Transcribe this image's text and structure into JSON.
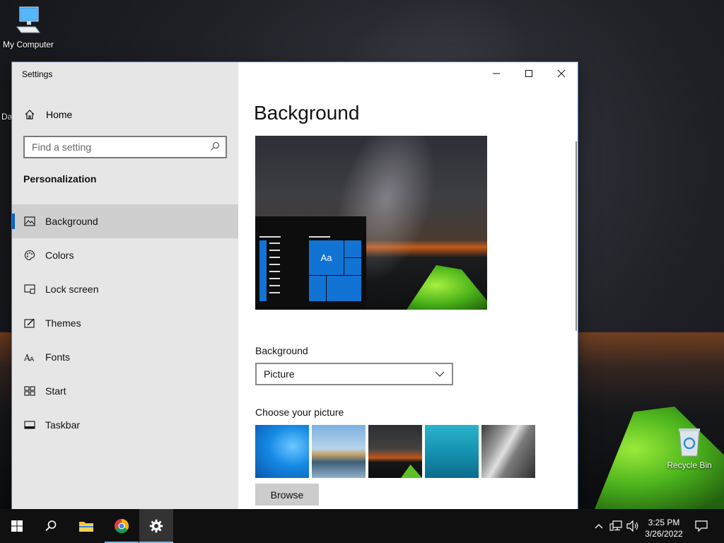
{
  "desktop": {
    "icons": [
      {
        "label": "My Computer"
      },
      {
        "label": "Recycle Bin"
      }
    ],
    "partial_label": "Da"
  },
  "window": {
    "app_title": "Settings",
    "controls": {
      "minimize": "—",
      "maximize": "☐",
      "close": "✕"
    },
    "sidebar": {
      "home_label": "Home",
      "search_placeholder": "Find a setting",
      "section_title": "Personalization",
      "items": [
        {
          "label": "Background",
          "icon": "background-icon",
          "active": true
        },
        {
          "label": "Colors",
          "icon": "palette-icon",
          "active": false
        },
        {
          "label": "Lock screen",
          "icon": "lock-screen-icon",
          "active": false
        },
        {
          "label": "Themes",
          "icon": "themes-icon",
          "active": false
        },
        {
          "label": "Fonts",
          "icon": "fonts-icon",
          "active": false
        },
        {
          "label": "Start",
          "icon": "start-icon",
          "active": false
        },
        {
          "label": "Taskbar",
          "icon": "taskbar-icon",
          "active": false
        }
      ]
    },
    "content": {
      "title": "Background",
      "preview_tile_label": "Aa",
      "background_label": "Background",
      "background_value": "Picture",
      "choose_label": "Choose your picture",
      "browse_label": "Browse"
    }
  },
  "taskbar": {
    "time": "3:25 PM",
    "date": "3/26/2022"
  },
  "colors": {
    "accent": "#0a63c9",
    "tile_blue": "#1173d4",
    "sidebar_bg": "#e6e6e6",
    "taskbar_bg": "#101010"
  }
}
